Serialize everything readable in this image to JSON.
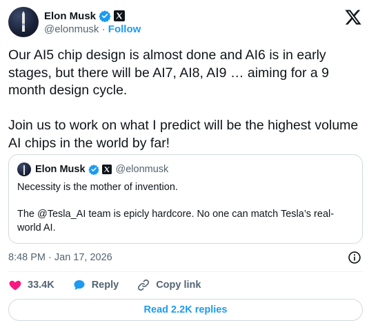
{
  "author": {
    "name": "Elon Musk",
    "handle": "@elonmusk",
    "separator": "·",
    "follow_label": "Follow",
    "verified_icon": "verified-badge-icon",
    "affiliate_icon": "x-affiliate-icon"
  },
  "tweet": {
    "text": "Our AI5 chip design is almost done and AI6 is in early stages, but there will be AI7, AI8, AI9 … aiming for a 9 month design cycle.\n\nJoin us to work on what I predict will be the highest volume AI chips in the world by far!",
    "timestamp": "8:48 PM · Jan 17, 2026"
  },
  "quoted_tweet": {
    "name": "Elon Musk",
    "handle": "@elonmusk",
    "text": "Necessity is the mother of invention.\n\nThe @Tesla_AI team is epicly hardcore. No one can match Tesla’s real-world AI."
  },
  "actions": {
    "likes": "33.4K",
    "reply_label": "Reply",
    "copy_link_label": "Copy link"
  },
  "read_replies_label": "Read 2.2K replies",
  "colors": {
    "accent": "#1d9bf0",
    "like": "#f91880",
    "text": "#0f1419",
    "muted": "#536471",
    "border": "#cfd9de"
  }
}
